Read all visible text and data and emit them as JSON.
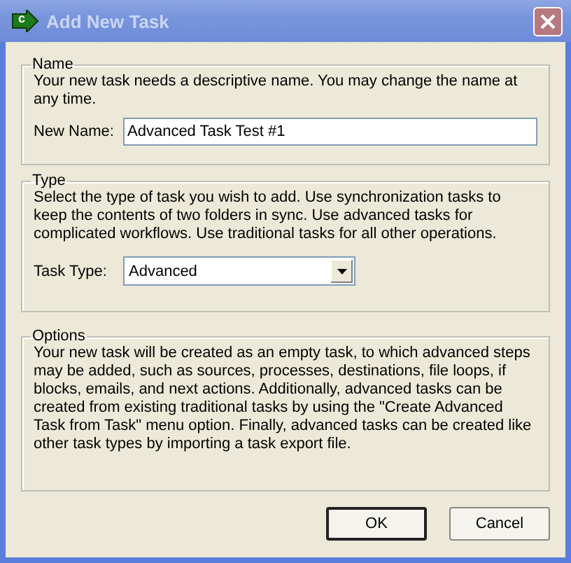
{
  "window": {
    "title": "Add New Task",
    "icon_letter": "c"
  },
  "name_group": {
    "title": "Name",
    "description": "Your new task needs a descriptive name.  You may change the name at any time.",
    "field_label": "New Name:",
    "value": "Advanced Task Test #1"
  },
  "type_group": {
    "title": "Type",
    "description": "Select the type of task you wish to add. Use synchronization tasks to keep the contents of two folders in sync. Use advanced tasks for complicated workflows. Use traditional tasks for all other operations.",
    "field_label": "Task Type:",
    "value": "Advanced"
  },
  "options_group": {
    "title": "Options",
    "description": "Your new task will be created as an empty task, to which advanced steps may be added, such as sources, processes, destinations, file loops, if blocks, emails, and next actions. Additionally, advanced tasks can be created from existing traditional tasks by using the \"Create Advanced Task from Task\" menu option. Finally, advanced tasks can be created like other task types by importing a task export file."
  },
  "buttons": [
    {
      "label": "OK",
      "default": true
    },
    {
      "label": "Cancel",
      "default": false
    }
  ]
}
